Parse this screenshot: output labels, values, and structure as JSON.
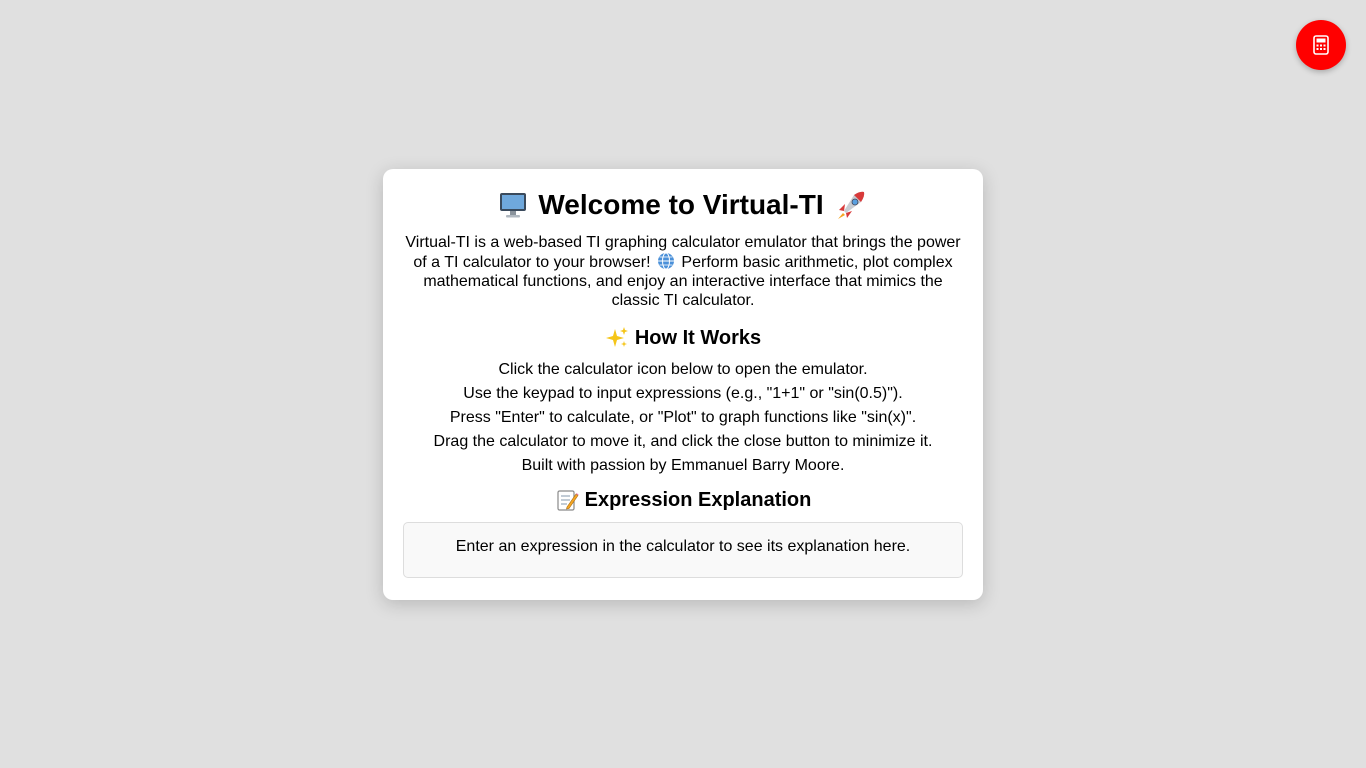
{
  "fab": {
    "icon": "calculator-icon",
    "color": "#ff0000"
  },
  "card": {
    "title": "Welcome to Virtual-TI",
    "title_icon_left": "desktop-computer-icon",
    "title_icon_right": "rocket-icon",
    "intro_part1": "Virtual-TI is a web-based TI graphing calculator emulator that brings the power of a TI calculator to your browser!",
    "intro_icon": "globe-icon",
    "intro_part2": "Perform basic arithmetic, plot complex mathematical functions, and enjoy an interactive interface that mimics the classic TI calculator.",
    "how_it_works": {
      "icon": "sparkles-icon",
      "title": "How It Works",
      "steps": [
        "Click the calculator icon below to open the emulator.",
        "Use the keypad to input expressions (e.g., \"1+1\" or \"sin(0.5)\").",
        "Press \"Enter\" to calculate, or \"Plot\" to graph functions like \"sin(x)\".",
        "Drag the calculator to move it, and click the close button to minimize it.",
        "Built with passion by Emmanuel Barry Moore."
      ]
    },
    "explanation": {
      "icon": "memo-icon",
      "title": "Expression Explanation",
      "placeholder_text": "Enter an expression in the calculator to see its explanation here."
    }
  }
}
